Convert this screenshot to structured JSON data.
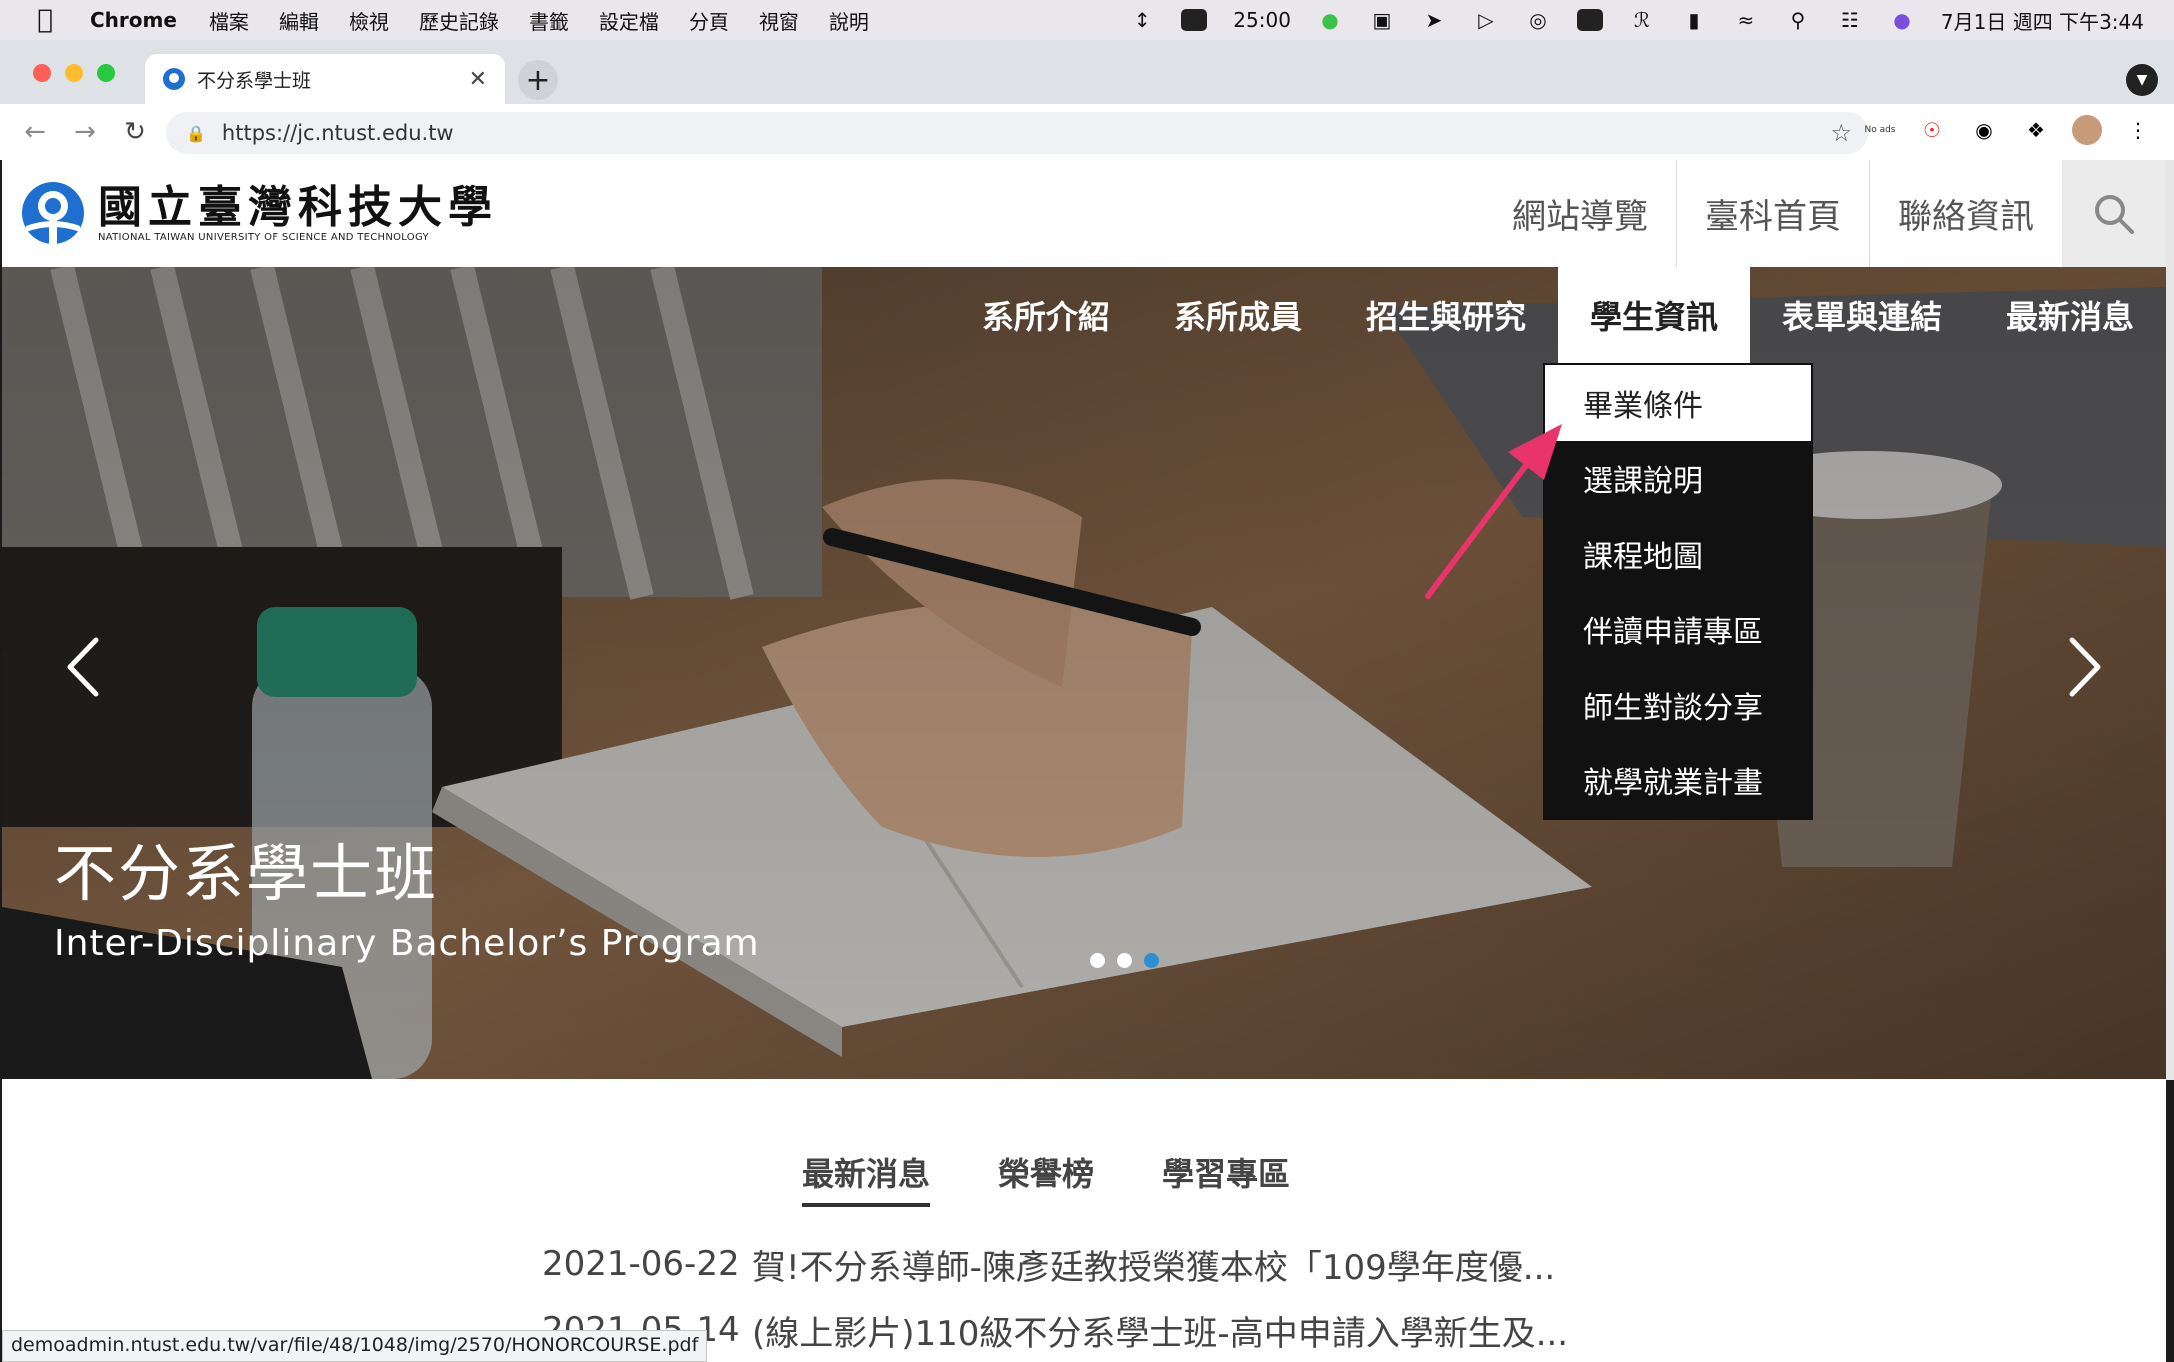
{
  "menubar": {
    "app": "Chrome",
    "items": [
      "檔案",
      "編輯",
      "檢視",
      "歷史記錄",
      "書籤",
      "設定檔",
      "分頁",
      "視窗",
      "說明"
    ],
    "timer": "25:00",
    "clock": "7月1日 週四 下午3:44"
  },
  "browser": {
    "tab_title": "不分系學士班",
    "url": "https://jc.ntust.edu.tw",
    "noads_label": "No ads",
    "status_url": "demoadmin.ntust.edu.tw/var/file/48/1048/img/2570/HONORCOURSE.pdf"
  },
  "site": {
    "logo_zh": "國立臺灣科技大學",
    "logo_en": "NATIONAL TAIWAN UNIVERSITY OF SCIENCE AND TECHNOLOGY",
    "util_links": [
      "網站導覽",
      "臺科首頁",
      "聯絡資訊"
    ],
    "main_nav": [
      "系所介紹",
      "系所成員",
      "招生與研究",
      "學生資訊",
      "表單與連結",
      "最新消息"
    ],
    "dropdown": [
      "畢業條件",
      "選課說明",
      "課程地圖",
      "伴讀申請專區",
      "師生對談分享",
      "就學就業計畫"
    ]
  },
  "hero": {
    "title": "不分系學士班",
    "subtitle": "Inter-Disciplinary Bachelor’s Program",
    "active_slide": 3,
    "slide_count": 3
  },
  "news": {
    "tabs": [
      "最新消息",
      "榮譽榜",
      "學習專區"
    ],
    "items": [
      {
        "date": "2021-06-22",
        "title": "賀!不分系導師-陳彥廷教授榮獲本校「109學年度優..."
      },
      {
        "date": "2021-05-14",
        "title": "(線上影片)110級不分系學士班-高中申請入學新生及..."
      }
    ]
  },
  "colors": {
    "logo_blue": "#1f6fd1",
    "annotation_arrow": "#e8336b",
    "slider_dot_active": "#2f8fd3"
  }
}
